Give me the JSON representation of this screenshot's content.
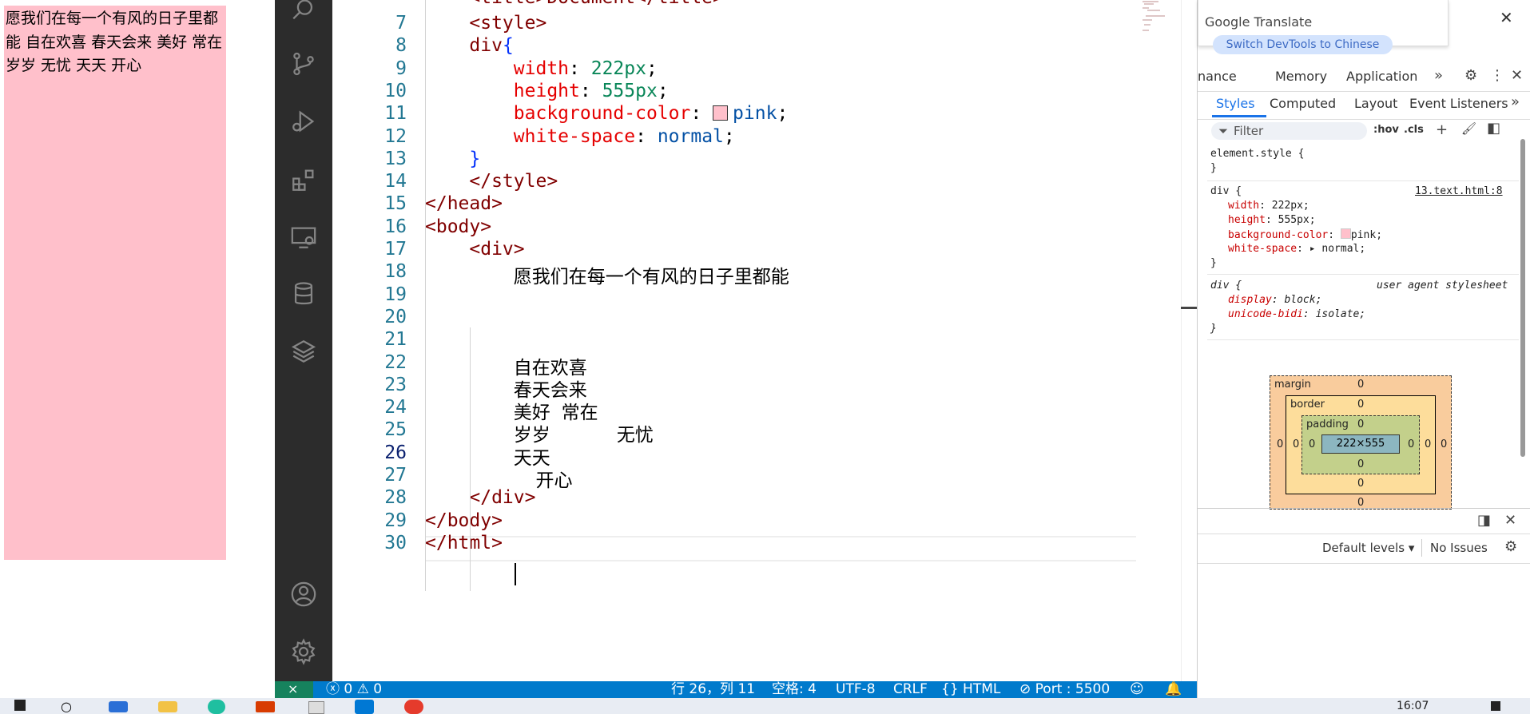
{
  "preview": {
    "text": "愿我们在每一个有风的日子里都能 自在欢喜 春天会来 美好 常在 岁岁 无忧 天天 开心"
  },
  "editor": {
    "top_partial": "    <title>Document</title>",
    "lines": [
      {
        "n": "7",
        "parts": [
          {
            "t": "    "
          },
          {
            "c": "tag",
            "t": "<style>"
          }
        ]
      },
      {
        "n": "8",
        "parts": [
          {
            "t": "    "
          },
          {
            "c": "tag",
            "t": "div"
          },
          {
            "c": "brace",
            "t": "{"
          }
        ]
      },
      {
        "n": "9",
        "parts": [
          {
            "t": "        "
          },
          {
            "c": "prop",
            "t": "width"
          },
          {
            "c": "txt",
            "t": ": "
          },
          {
            "c": "val",
            "t": "222px"
          },
          {
            "c": "txt",
            "t": ";"
          }
        ]
      },
      {
        "n": "10",
        "parts": [
          {
            "t": "        "
          },
          {
            "c": "prop",
            "t": "height"
          },
          {
            "c": "txt",
            "t": ": "
          },
          {
            "c": "val",
            "t": "555px"
          },
          {
            "c": "txt",
            "t": ";"
          }
        ]
      },
      {
        "n": "11",
        "parts": [
          {
            "t": "        "
          },
          {
            "c": "prop",
            "t": "background-color"
          },
          {
            "c": "txt",
            "t": ": "
          },
          {
            "c": "swatch",
            "t": ""
          },
          {
            "c": "kw",
            "t": "pink"
          },
          {
            "c": "txt",
            "t": ";"
          }
        ]
      },
      {
        "n": "12",
        "parts": [
          {
            "t": "        "
          },
          {
            "c": "prop",
            "t": "white-space"
          },
          {
            "c": "txt",
            "t": ": "
          },
          {
            "c": "kw",
            "t": "normal"
          },
          {
            "c": "txt",
            "t": ";"
          }
        ]
      },
      {
        "n": "13",
        "parts": [
          {
            "t": "    "
          },
          {
            "c": "brace",
            "t": "}"
          }
        ]
      },
      {
        "n": "14",
        "parts": [
          {
            "t": "    "
          },
          {
            "c": "tag",
            "t": "</style>"
          }
        ]
      },
      {
        "n": "15",
        "parts": [
          {
            "c": "tag",
            "t": "</head>"
          }
        ]
      },
      {
        "n": "16",
        "parts": [
          {
            "c": "tag",
            "t": "<body>"
          }
        ]
      },
      {
        "n": "17",
        "parts": [
          {
            "t": "    "
          },
          {
            "c": "tag",
            "t": "<div>"
          }
        ]
      },
      {
        "n": "18",
        "parts": [
          {
            "t": "        "
          },
          {
            "c": "txt",
            "t": "愿我们在每一个有风的日子里都能"
          }
        ]
      },
      {
        "n": "19",
        "parts": []
      },
      {
        "n": "20",
        "parts": []
      },
      {
        "n": "21",
        "parts": []
      },
      {
        "n": "22",
        "parts": [
          {
            "t": "        "
          },
          {
            "c": "txt",
            "t": "自在欢喜"
          }
        ]
      },
      {
        "n": "23",
        "parts": [
          {
            "t": "        "
          },
          {
            "c": "txt",
            "t": "春天会来"
          }
        ]
      },
      {
        "n": "24",
        "parts": [
          {
            "t": "        "
          },
          {
            "c": "txt",
            "t": "美好 常在"
          }
        ]
      },
      {
        "n": "25",
        "parts": [
          {
            "t": "        "
          },
          {
            "c": "txt",
            "t": "岁岁      无忧"
          }
        ]
      },
      {
        "n": "26",
        "parts": [
          {
            "t": "        "
          },
          {
            "c": "txt",
            "t": "天天"
          }
        ]
      },
      {
        "n": "27",
        "parts": [
          {
            "t": "        "
          },
          {
            "c": "txt",
            "t": "  开心"
          }
        ]
      },
      {
        "n": "28",
        "parts": [
          {
            "t": "    "
          },
          {
            "c": "tag",
            "t": "</div>"
          }
        ]
      },
      {
        "n": "29",
        "parts": [
          {
            "c": "tag",
            "t": "</body>"
          }
        ]
      },
      {
        "n": "30",
        "parts": [
          {
            "c": "tag",
            "t": "</html>"
          }
        ]
      }
    ],
    "active_line": "26",
    "colors": {
      "tag": "#800000",
      "prop": "#e50000",
      "val": "#098658",
      "kw": "#0451a5",
      "brace": "#0431fa",
      "txt": "#000000",
      "swatch": "#ffc0cb"
    }
  },
  "statusbar": {
    "errors": "0",
    "warnings": "0",
    "position": "行 26，列 11",
    "spaces": "空格: 4",
    "encoding": "UTF-8",
    "eol": "CRLF",
    "language": "HTML",
    "port": "Port : 5500"
  },
  "devtools": {
    "translate_title": "Google Translate",
    "translate_button": "Switch DevTools to Chinese",
    "top_tabs": [
      "nance",
      "Memory",
      "Application"
    ],
    "sub_tabs": [
      "Styles",
      "Computed",
      "Layout",
      "Event Listeners"
    ],
    "filter_placeholder": "Filter",
    "hov": ":hov",
    "cls": ".cls",
    "element_style": "element.style {",
    "close_brace": "}",
    "rule_selector": "div {",
    "rule_source": "13.text.html:8",
    "rule_props": [
      {
        "name": "width",
        "value": "222px;"
      },
      {
        "name": "height",
        "value": "555px;"
      },
      {
        "name": "background-color",
        "value": "pink;"
      },
      {
        "name": "white-space",
        "value": "normal;"
      }
    ],
    "ua_selector": "div {",
    "ua_source": "user agent stylesheet",
    "ua_props": [
      {
        "name": "display",
        "value": "block;"
      },
      {
        "name": "unicode-bidi",
        "value": "isolate;"
      }
    ],
    "box": {
      "margin": "margin",
      "border": "border",
      "padding": "padding",
      "zero": "0",
      "content": "222×555"
    },
    "console_levels": "Default levels",
    "console_issues": "No Issues"
  },
  "taskbar": {
    "time": "16:07"
  }
}
